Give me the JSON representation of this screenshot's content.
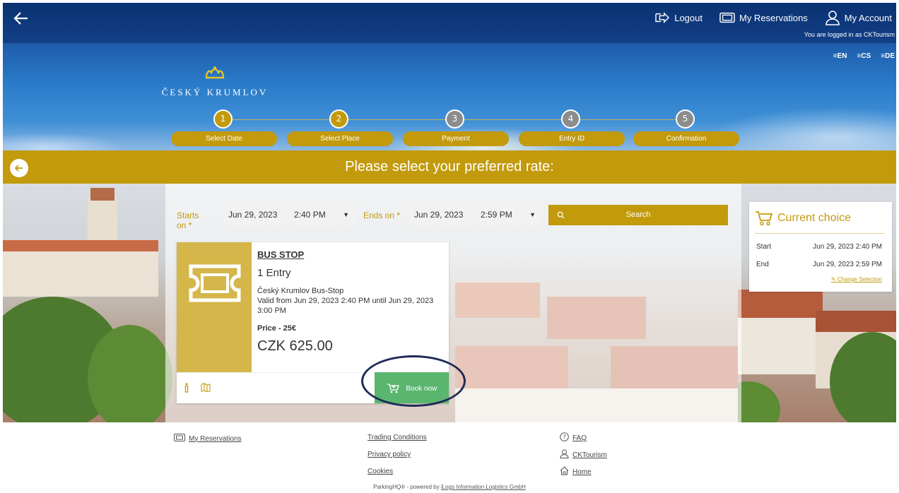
{
  "topnav": {
    "logout_label": "Logout",
    "reservations_label": "My Reservations",
    "account_label": "My Account",
    "logged_in_text": "You are logged in as CKTourism"
  },
  "languages": [
    "≡EN",
    "≡CS",
    "≡DE"
  ],
  "brand": {
    "name": "ČESKÝ KRUMLOV"
  },
  "steps": [
    {
      "number": "1",
      "label": "Select Date",
      "state": "active"
    },
    {
      "number": "2",
      "label": "Select Place",
      "state": "active"
    },
    {
      "number": "3",
      "label": "Payment",
      "state": "inactive"
    },
    {
      "number": "4",
      "label": "Entry ID",
      "state": "inactive"
    },
    {
      "number": "5",
      "label": "Confirmation",
      "state": "inactive"
    }
  ],
  "banner": {
    "title": "Please select your preferred rate:"
  },
  "filter": {
    "starts_label": "Starts on *",
    "start_date": "Jun 29, 2023",
    "start_time": "2:40 PM",
    "ends_label": "Ends on *",
    "end_date": "Jun 29, 2023",
    "end_time": "2:59 PM",
    "search_label": "Search"
  },
  "product": {
    "name": "BUS STOP",
    "quantity": "1 Entry",
    "location": "Český Krumlov Bus-Stop",
    "validity": "Valid from Jun 29, 2023 2:40 PM until Jun 29, 2023 3:00 PM",
    "price_label": "Price - 25€",
    "price": "CZK 625.00",
    "book_label": "Book now"
  },
  "current_choice": {
    "title": "Current choice",
    "start_label": "Start",
    "start_value": "Jun 29, 2023 2:40 PM",
    "end_label": "End",
    "end_value": "Jun 29, 2023 2:59 PM",
    "change_label": "Change Selection"
  },
  "footer": {
    "my_reservations": "My Reservations",
    "trading_conditions": "Trading Conditions",
    "privacy_policy": "Privacy policy",
    "cookies": "Cookies",
    "faq": "FAQ",
    "account": "CKTourism",
    "home": "Home",
    "powered_prefix": "ParkingHQ® - powered by ",
    "powered_company": "iLogs Information Logistics GmbH"
  },
  "colors": {
    "gold": "#c29a0c",
    "green": "#5ab56f",
    "navy": "#0a3272",
    "step_inactive": "#8c8c8c"
  }
}
